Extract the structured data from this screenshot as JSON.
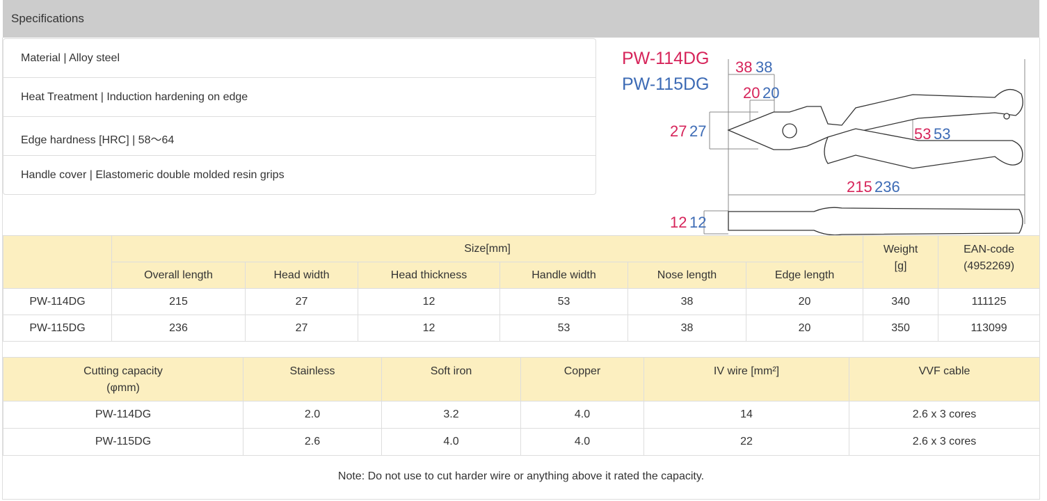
{
  "header": {
    "title": "Specifications"
  },
  "specs": [
    "Material | Alloy steel",
    "Heat Treatment | Induction hardening on edge",
    "Edge hardness [HRC] | 58～64",
    "Handle cover | Elastomeric double molded resin grips"
  ],
  "drawing": {
    "model_a": "PW-114DG",
    "model_b": "PW-115DG",
    "nose_a": "38",
    "nose_b": "38",
    "edge_a": "20",
    "edge_b": "20",
    "head_a": "27",
    "head_b": "27",
    "handle_a": "53",
    "handle_b": "53",
    "length_a": "215",
    "length_b": "236",
    "thick_a": "12",
    "thick_b": "12",
    "color_a": "#d6245a",
    "color_b": "#3d6bb5"
  },
  "size_table": {
    "group": "Size[mm]",
    "weight": "Weight [g]",
    "ean": "EAN-code (4952269)",
    "columns": [
      "Overall length",
      "Head width",
      "Head thickness",
      "Handle width",
      "Nose length",
      "Edge length"
    ],
    "rows": [
      [
        "PW-114DG",
        "215",
        "27",
        "12",
        "53",
        "38",
        "20",
        "340",
        "111125"
      ],
      [
        "PW-115DG",
        "236",
        "27",
        "12",
        "53",
        "38",
        "20",
        "350",
        "113099"
      ]
    ]
  },
  "cut_table": {
    "columns": [
      "Cutting capacity (φmm)",
      "Stainless",
      "Soft iron",
      "Copper",
      "IV wire [mm²]",
      "VVF cable"
    ],
    "rows": [
      [
        "PW-114DG",
        "2.0",
        "3.2",
        "4.0",
        "14",
        "2.6 x 3 cores"
      ],
      [
        "PW-115DG",
        "2.6",
        "4.0",
        "4.0",
        "22",
        "2.6 x 3 cores"
      ]
    ]
  },
  "note": "Note: Do not use to cut harder wire or anything above it rated the capacity."
}
